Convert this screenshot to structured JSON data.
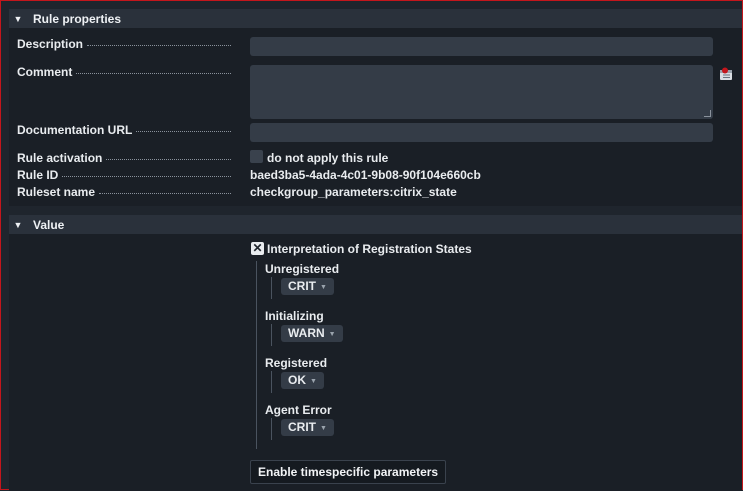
{
  "rule_properties": {
    "title": "Rule properties",
    "labels": {
      "description": "Description",
      "comment": "Comment",
      "documentation_url": "Documentation URL",
      "rule_activation": "Rule activation",
      "rule_id": "Rule ID",
      "ruleset_name": "Ruleset name"
    },
    "description_value": "",
    "comment_value": "",
    "documentation_url_value": "",
    "activation_checkbox_label": "do not apply this rule",
    "rule_id_value": "baed3ba5-4ada-4c01-9b08-90f104e660cb",
    "ruleset_name_value": "checkgroup_parameters:citrix_state"
  },
  "value": {
    "title": "Value",
    "interpretation_label": "Interpretation of Registration States",
    "states": [
      {
        "label": "Unregistered",
        "value": "CRIT"
      },
      {
        "label": "Initializing",
        "value": "WARN"
      },
      {
        "label": "Registered",
        "value": "OK"
      },
      {
        "label": "Agent Error",
        "value": "CRIT"
      }
    ],
    "timespecific_button": "Enable timespecific parameters"
  },
  "colors": {
    "background": "#1f252d",
    "section_header": "#2a313b",
    "input": "#343c47",
    "border_accent": "#c4161c"
  }
}
